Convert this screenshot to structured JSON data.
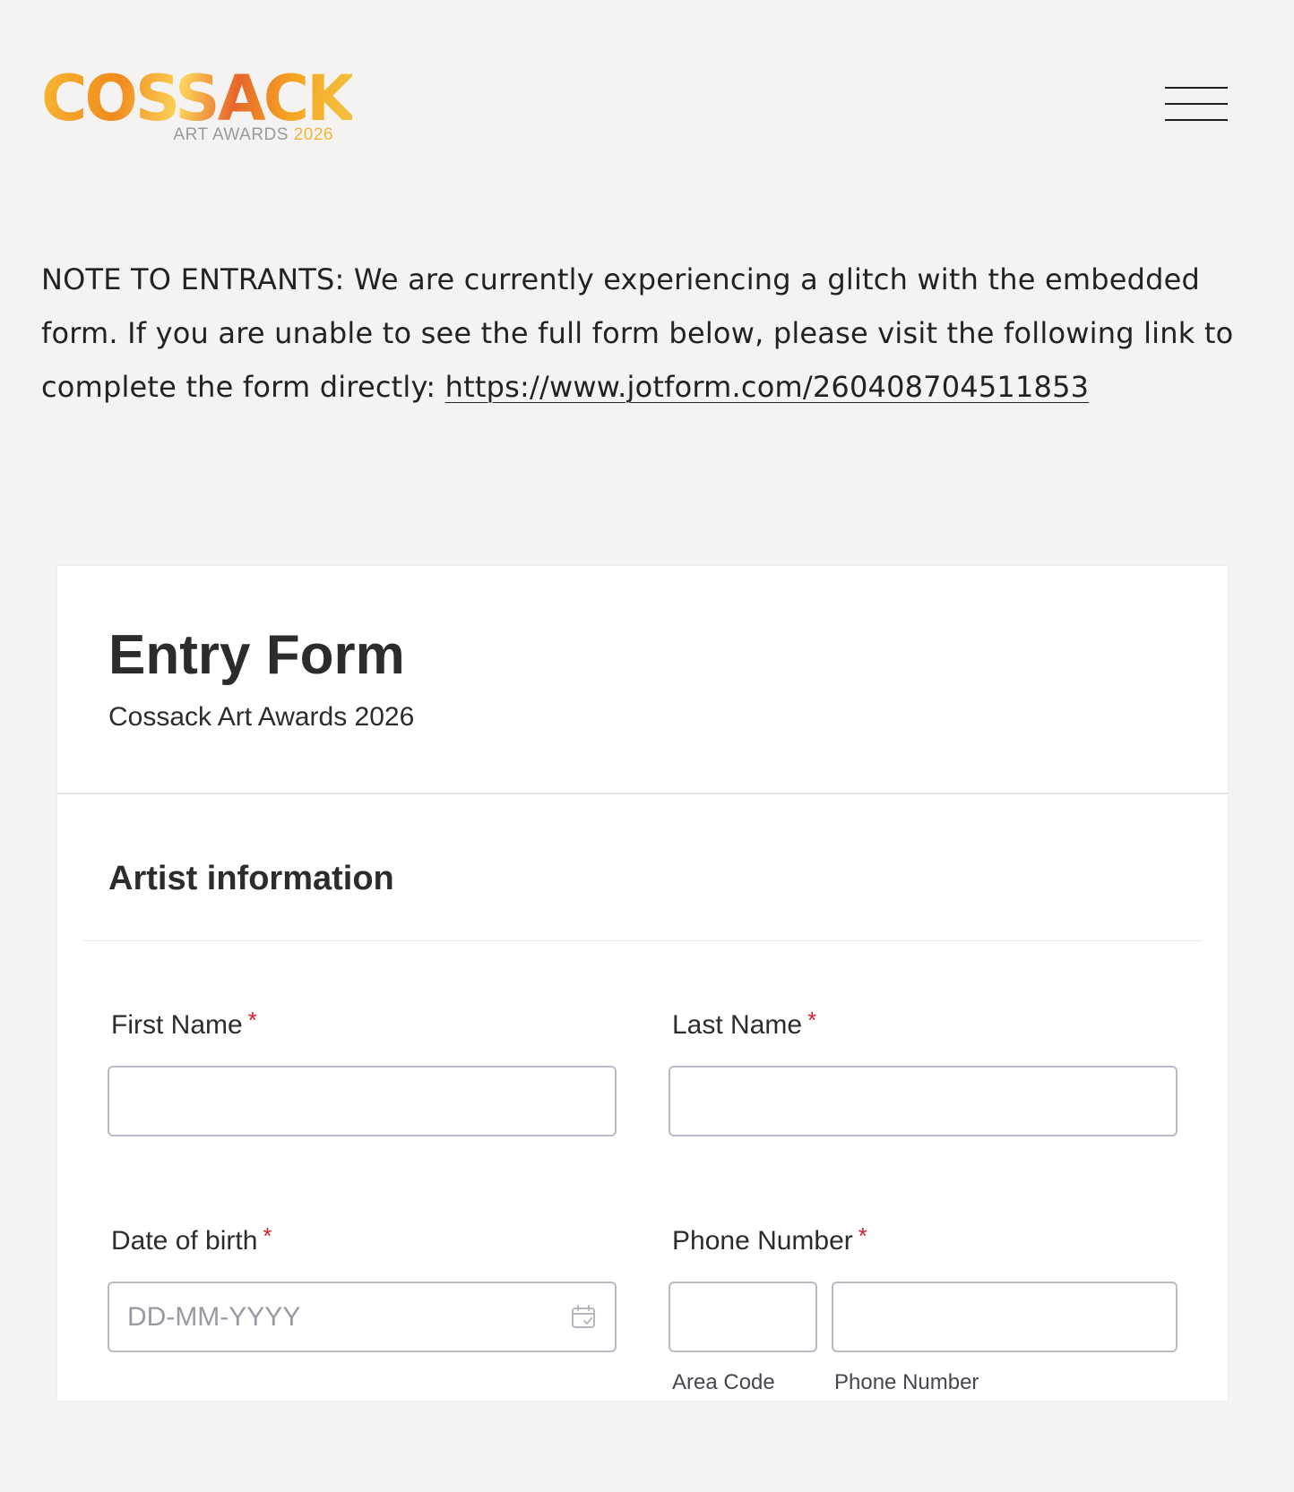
{
  "header": {
    "logo_word": "COSSACK",
    "logo_sub": "ART AWARDS",
    "logo_year": "2026",
    "menu_icon": "hamburger-menu-icon"
  },
  "note": {
    "text": "NOTE TO ENTRANTS: We are currently experiencing a glitch with the embedded form. If you are unable to see the full form below, please visit the following link to complete the form directly: ",
    "link_text": "https://www.jotform.com/260408704511853"
  },
  "form": {
    "title": "Entry Form",
    "subtitle": "Cossack Art Awards 2026",
    "section_title": "Artist information",
    "required_marker": "*",
    "fields": {
      "first_name": {
        "label": "First Name",
        "value": ""
      },
      "last_name": {
        "label": "Last Name",
        "value": ""
      },
      "date_of_birth": {
        "label": "Date of birth",
        "placeholder": "DD-MM-YYYY",
        "value": "",
        "icon": "calendar-icon"
      },
      "phone": {
        "label": "Phone Number",
        "area_code_sublabel": "Area Code",
        "number_sublabel": "Phone Number",
        "area_code_value": "",
        "number_value": ""
      }
    }
  },
  "colors": {
    "page_background": "#f4f3f1",
    "required": "#d0242e",
    "logo_orange": "#f08a1c",
    "logo_year": "#f2b43a"
  }
}
